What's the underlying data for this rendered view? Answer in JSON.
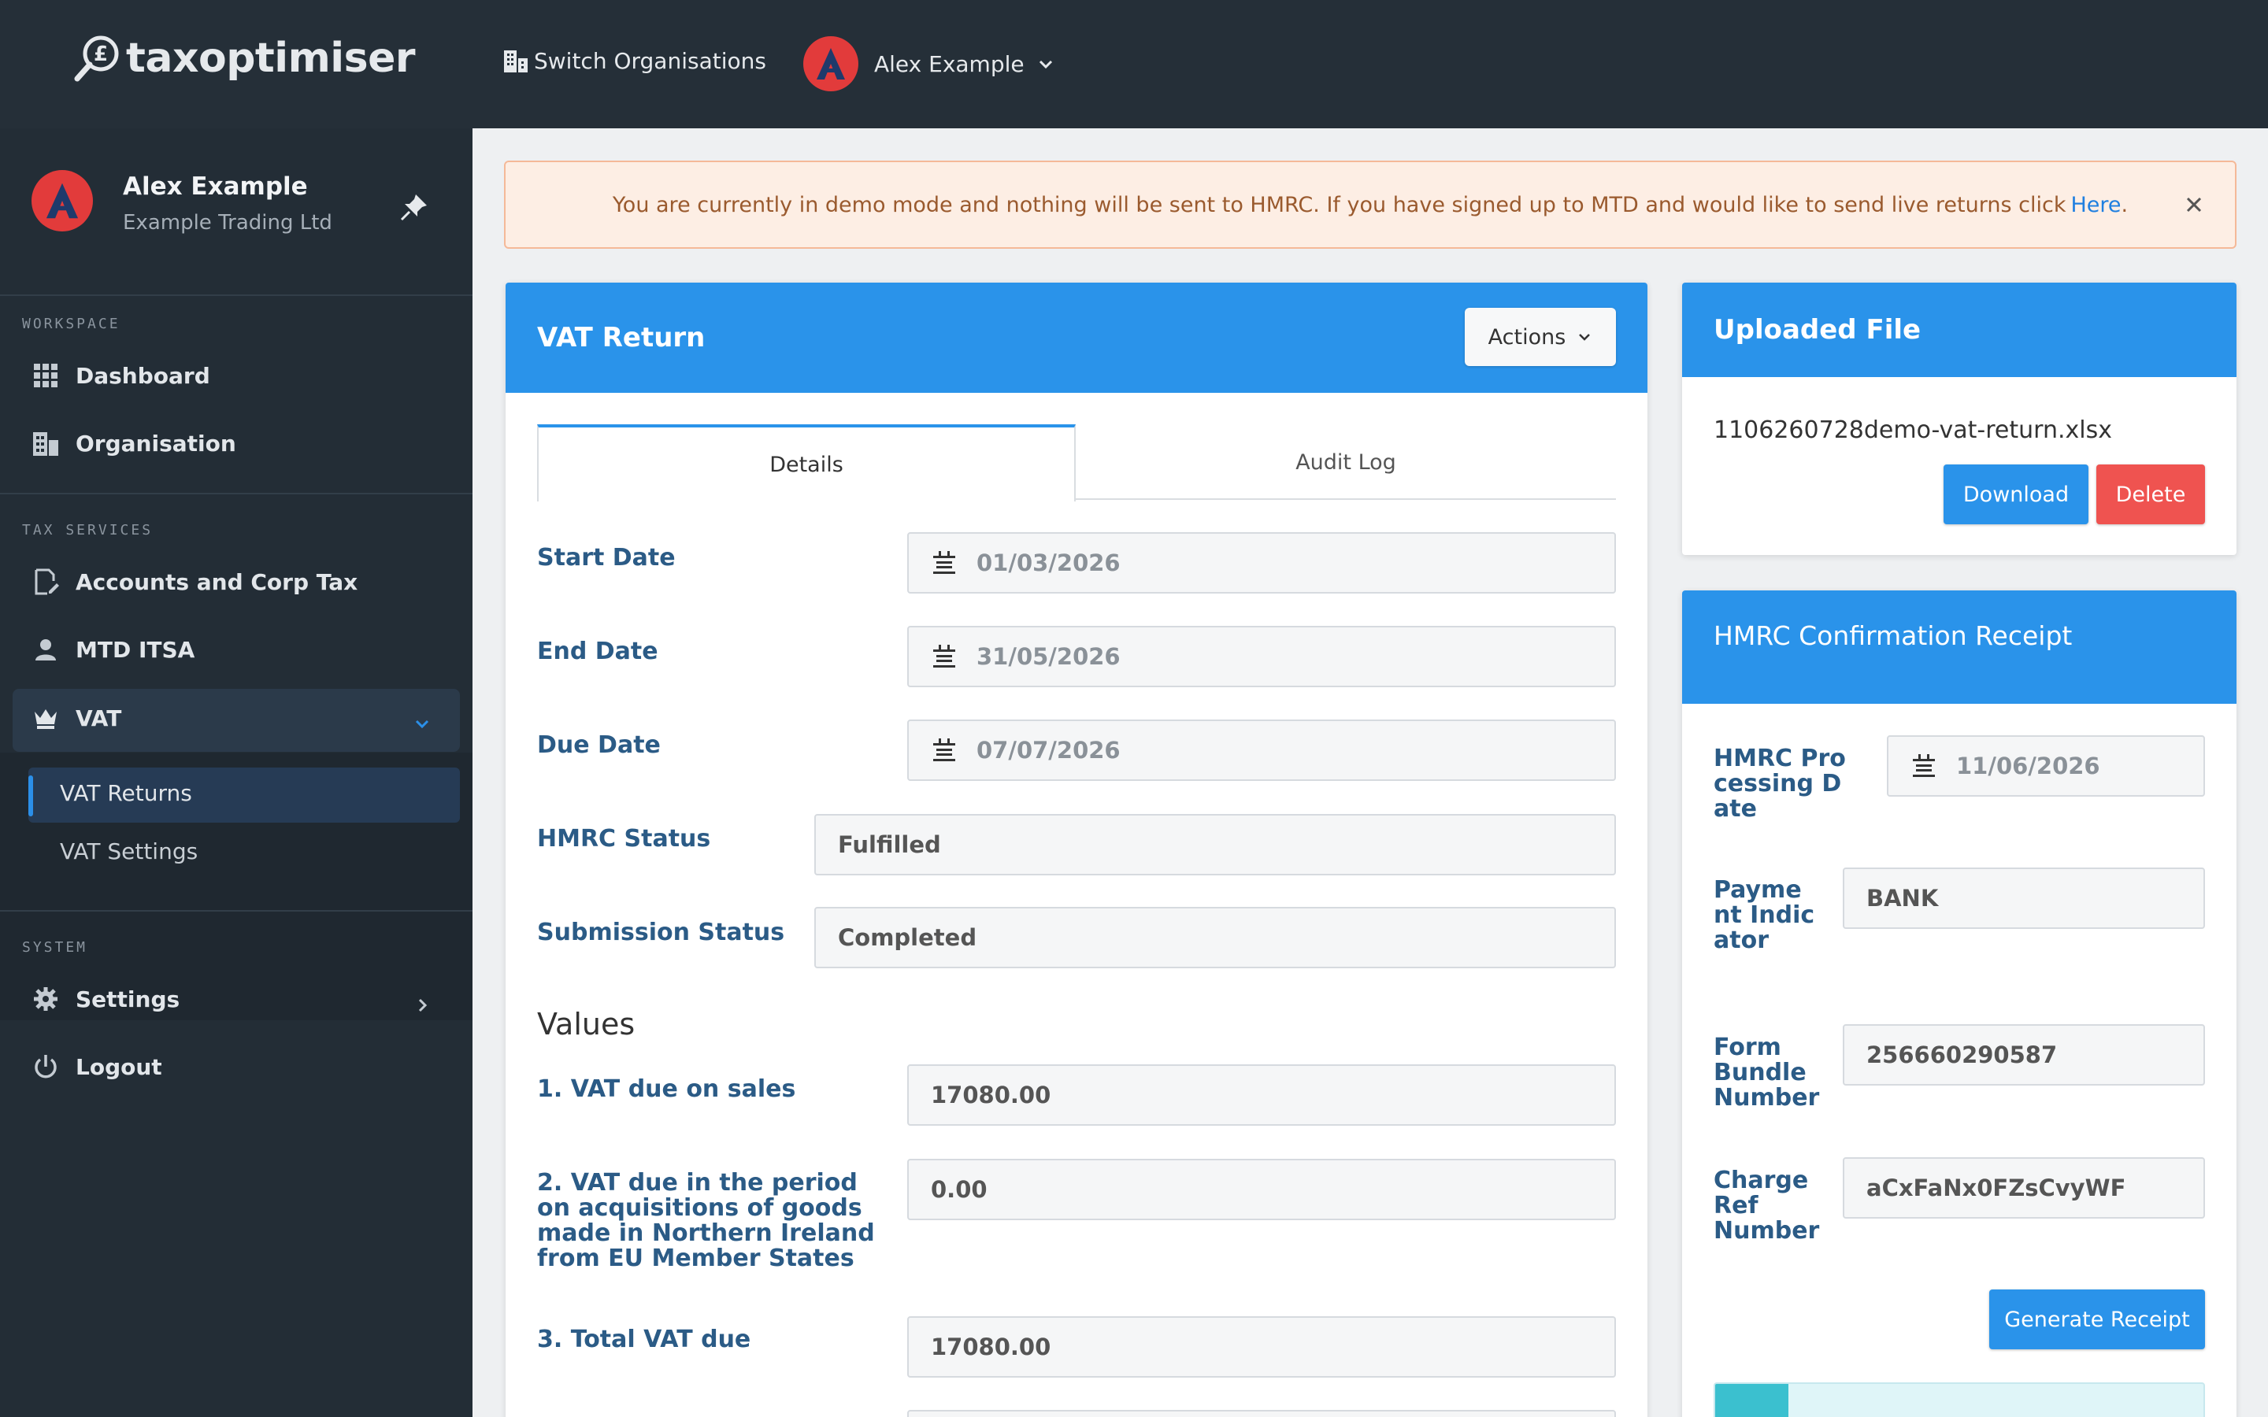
{
  "app": {
    "name": "taxoptimiser"
  },
  "topbar": {
    "switch_org": "Switch Organisations",
    "user": "Alex Example"
  },
  "sidebar": {
    "profile": {
      "name": "Alex Example",
      "org": "Example Trading Ltd"
    },
    "sections": {
      "workspace": "WORKSPACE",
      "tax_services": "TAX SERVICES",
      "system": "SYSTEM"
    },
    "items": {
      "dashboard": "Dashboard",
      "organisation": "Organisation",
      "accounts": "Accounts and Corp Tax",
      "mtd_itsa": "MTD ITSA",
      "vat": "VAT",
      "vat_returns": "VAT Returns",
      "vat_settings": "VAT Settings",
      "settings": "Settings",
      "logout": "Logout"
    }
  },
  "alert": {
    "message": "You are currently in demo mode and nothing will be sent to HMRC. If you have signed up to MTD and would like to send live returns click",
    "link": "Here",
    "suffix": "."
  },
  "vat_return": {
    "title": "VAT Return",
    "actions_label": "Actions",
    "tabs": {
      "details": "Details",
      "audit_log": "Audit Log"
    },
    "fields": {
      "start_date_label": "Start Date",
      "start_date": "01/03/2026",
      "end_date_label": "End Date",
      "end_date": "31/05/2026",
      "due_date_label": "Due Date",
      "due_date": "07/07/2026",
      "hmrc_status_label": "HMRC Status",
      "hmrc_status": "Fulfilled",
      "submission_status_label": "Submission Status",
      "submission_status": "Completed"
    },
    "values_heading": "Values",
    "values": {
      "box1_label": "1. VAT due on sales",
      "box1": "17080.00",
      "box2_label": "2. VAT due in the period on acquisitions of goods made in Northern Ireland from EU Member States",
      "box2": "0.00",
      "box3_label": "3. Total VAT due",
      "box3": "17080.00"
    }
  },
  "uploaded_file": {
    "title": "Uploaded File",
    "file_name": "1106260728demo-vat-return.xlsx",
    "download_label": "Download",
    "delete_label": "Delete"
  },
  "receipt": {
    "title": "HMRC Confirmation Receipt",
    "processing_date_label": "HMRC Processing Date",
    "processing_date": "11/06/2026",
    "payment_indicator_label": "Payment Indicator",
    "payment_indicator": "BANK",
    "form_bundle_label": "Form Bundle Number",
    "form_bundle": "256660290587",
    "charge_ref_label": "Charge Ref Number",
    "charge_ref": "aCxFaNx0FZsCvyWF",
    "generate_label": "Generate Receipt"
  },
  "colors": {
    "accent": "#2a93ea",
    "danger": "#ef5350",
    "sidebar": "#232d36",
    "topbar": "#252f38",
    "label": "#2b5b86"
  }
}
